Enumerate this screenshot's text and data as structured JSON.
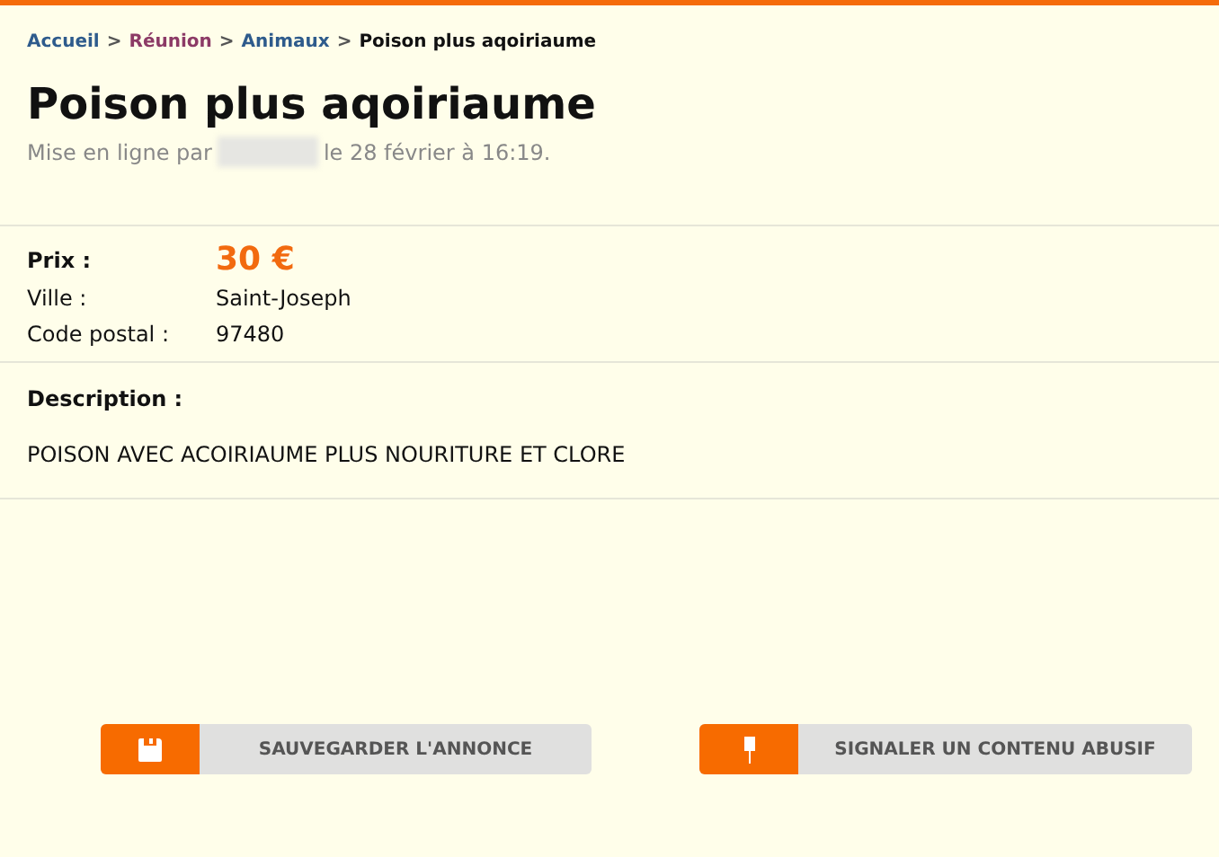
{
  "breadcrumb": [
    {
      "kind": "link",
      "label": "Accueil",
      "color": "#2e5b8c"
    },
    {
      "kind": "separator",
      "label": ">"
    },
    {
      "kind": "link",
      "label": "Réunion",
      "color": "#8c3a66"
    },
    {
      "kind": "separator",
      "label": ">"
    },
    {
      "kind": "link",
      "label": "Animaux",
      "color": "#2e5b8c"
    },
    {
      "kind": "separator",
      "label": ">"
    },
    {
      "kind": "current",
      "label": "Poison plus aqoiriaume"
    }
  ],
  "title": "Poison plus aqoiriaume",
  "posted": {
    "prefix": "Mise en ligne par",
    "suffix": "le 28 février à 16:19."
  },
  "details": [
    {
      "label": "Prix :",
      "value": "30 €",
      "kind": "price"
    },
    {
      "label": "Ville :",
      "value": "Saint-Joseph",
      "kind": "plain"
    },
    {
      "label": "Code postal :",
      "value": "97480",
      "kind": "plain"
    }
  ],
  "description": {
    "label": "Description :",
    "text": "POISON AVEC ACOIRIAUME PLUS NOURITURE ET CLORE"
  },
  "buttons": [
    {
      "kind": "save",
      "label": "SAUVEGARDER L'ANNONCE"
    },
    {
      "kind": "report",
      "label": "SIGNALER UN CONTENU ABUSIF"
    }
  ]
}
